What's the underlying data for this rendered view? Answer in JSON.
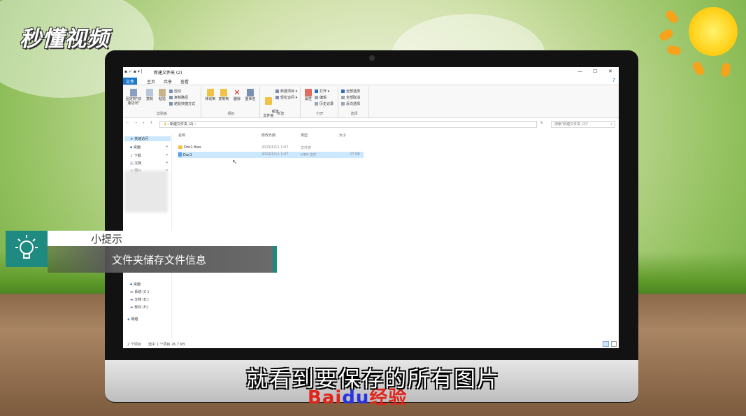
{
  "brand": {
    "logo_text": "秒懂视频",
    "watermark_left": "Bai",
    "watermark_mid": "du",
    "watermark_right": "经验"
  },
  "explorer": {
    "window_title": "新建文件夹 (2)",
    "window_buttons": {
      "minimize": "—",
      "maximize": "☐",
      "close": "✕"
    },
    "menu_tabs": [
      "文件",
      "主页",
      "共享",
      "查看"
    ],
    "ribbon": {
      "clipboard": {
        "pin": "固定到\"快速访问\"",
        "copy": "复制",
        "paste": "粘贴",
        "cut": "剪切",
        "copy_path": "复制路径",
        "paste_shortcut": "粘贴快捷方式",
        "label": "剪贴板"
      },
      "organize": {
        "move_to": "移动到",
        "copy_to": "复制到",
        "delete": "删除",
        "rename": "重命名",
        "label": "组织"
      },
      "new": {
        "new_folder": "新建\n文件夹",
        "new_item": "新建项目 ▾",
        "easy_access": "轻松访问 ▾",
        "label": "新建"
      },
      "open": {
        "properties": "属性",
        "open": "打开 ▾",
        "edit": "编辑",
        "history": "历史记录",
        "label": "打开"
      },
      "select": {
        "select_all": "全部选择",
        "select_none": "全部取消",
        "invert": "反向选择",
        "label": "选择"
      }
    },
    "address": {
      "path": "新建文件夹 (2)",
      "search_placeholder": "搜索\"新建文件夹 (2)\""
    },
    "nav": {
      "quick_access": "快速访问",
      "items": [
        "桌面",
        "下载",
        "文档",
        "图片"
      ],
      "bottom_items": [
        "桌面",
        "系统 (C:)",
        "文档 (E:)",
        "软件 (F:)"
      ],
      "network": "网络"
    },
    "columns": {
      "name": "名称",
      "modified": "修改日期",
      "type": "类型",
      "size": "大小"
    },
    "files": [
      {
        "name": "Doc1.files",
        "modified": "2019/5/11 1:07",
        "type": "文件夹",
        "size": ""
      },
      {
        "name": "Doc1",
        "modified": "2019/5/11 1:07",
        "type": "HTM 文件",
        "size": "27 KB"
      }
    ],
    "status": {
      "count": "2 个项目",
      "selection": "选中 1 个项目  26.7 KB"
    }
  },
  "tip": {
    "heading": "小提示",
    "body": "文件夹储存文件信息"
  },
  "subtitle": "就看到要保存的所有图片"
}
